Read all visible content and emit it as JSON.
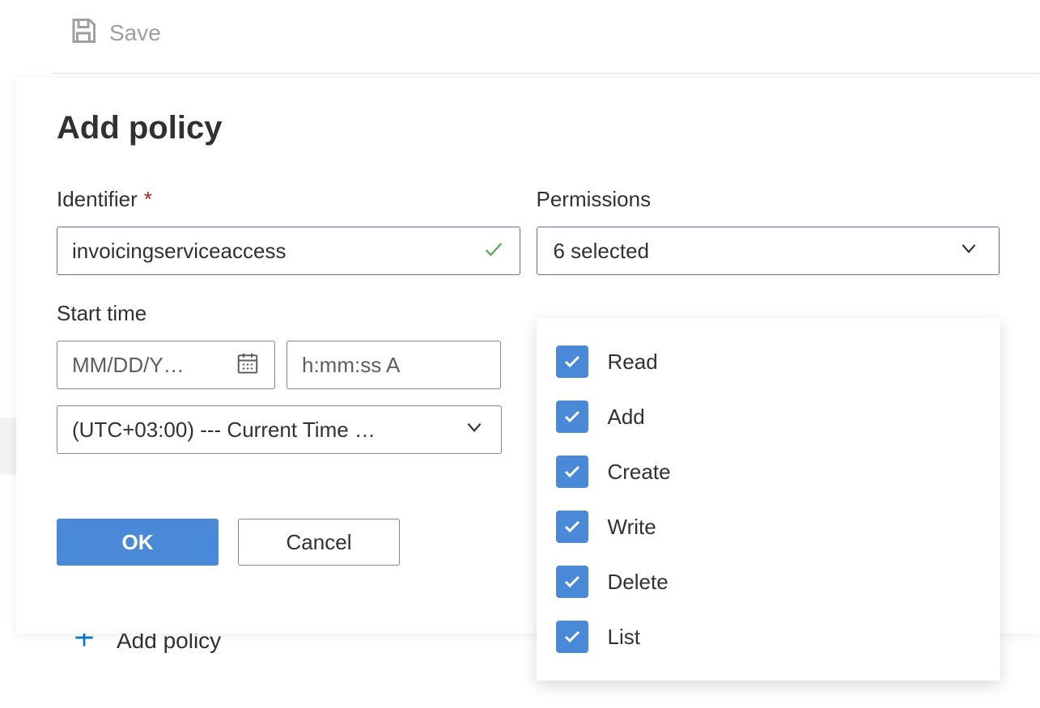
{
  "toolbar": {
    "save_label": "Save"
  },
  "panel": {
    "title": "Add policy"
  },
  "identifier": {
    "label": "Identifier",
    "required_mark": "*",
    "value": "invoicingserviceaccess"
  },
  "start_time": {
    "label": "Start time",
    "date_placeholder": "MM/DD/Y…",
    "time_placeholder": "h:mm:ss A",
    "timezone_display": "(UTC+03:00) --- Current Time …"
  },
  "permissions": {
    "label": "Permissions",
    "summary": "6 selected",
    "options": [
      {
        "label": "Read",
        "checked": true
      },
      {
        "label": "Add",
        "checked": true
      },
      {
        "label": "Create",
        "checked": true
      },
      {
        "label": "Write",
        "checked": true
      },
      {
        "label": "Delete",
        "checked": true
      },
      {
        "label": "List",
        "checked": true
      }
    ]
  },
  "buttons": {
    "ok": "OK",
    "cancel": "Cancel"
  },
  "background": {
    "add_policy": "Add policy"
  }
}
